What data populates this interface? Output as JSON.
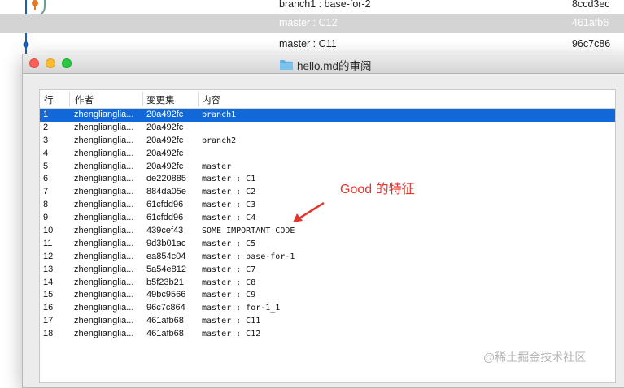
{
  "background_log": {
    "rows": [
      {
        "message": "branch1 : base-for-2",
        "hash": "8ccd3ec",
        "selected": false
      },
      {
        "message": "master : C12",
        "hash": "461afb6",
        "selected": true
      },
      {
        "message": "master : C11",
        "hash": "96c7c86",
        "selected": false
      }
    ],
    "graph_colors": {
      "main": "#1d5fb8",
      "branch": "#e07a2a",
      "line": "#6b9f87"
    }
  },
  "window": {
    "title": "hello.md的审阅",
    "folder_icon": "folder-icon"
  },
  "table": {
    "headers": {
      "line": "行",
      "author": "作者",
      "changeset": "变更集",
      "content": "内容"
    },
    "rows": [
      {
        "line": "1",
        "author": "zhenglianglia...",
        "changeset": "20a492fc",
        "content": "branch1",
        "selected": true
      },
      {
        "line": "2",
        "author": "zhenglianglia...",
        "changeset": "20a492fc",
        "content": ""
      },
      {
        "line": "3",
        "author": "zhenglianglia...",
        "changeset": "20a492fc",
        "content": "branch2"
      },
      {
        "line": "4",
        "author": "zhenglianglia...",
        "changeset": "20a492fc",
        "content": ""
      },
      {
        "line": "5",
        "author": "zhenglianglia...",
        "changeset": "20a492fc",
        "content": "master"
      },
      {
        "line": "6",
        "author": "zhenglianglia...",
        "changeset": "de220885",
        "content": "master : C1"
      },
      {
        "line": "7",
        "author": "zhenglianglia...",
        "changeset": "884da05e",
        "content": "master : C2"
      },
      {
        "line": "8",
        "author": "zhenglianglia...",
        "changeset": "61cfdd96",
        "content": "master : C3"
      },
      {
        "line": "9",
        "author": "zhenglianglia...",
        "changeset": "61cfdd96",
        "content": "master : C4"
      },
      {
        "line": "10",
        "author": "zhenglianglia...",
        "changeset": "439cef43",
        "content": "SOME IMPORTANT CODE"
      },
      {
        "line": "11",
        "author": "zhenglianglia...",
        "changeset": "9d3b01ac",
        "content": "master : C5"
      },
      {
        "line": "12",
        "author": "zhenglianglia...",
        "changeset": "ea854c04",
        "content": "master : base-for-1"
      },
      {
        "line": "13",
        "author": "zhenglianglia...",
        "changeset": "5a54e812",
        "content": "master : C7"
      },
      {
        "line": "14",
        "author": "zhenglianglia...",
        "changeset": "b5f23b21",
        "content": "master : C8"
      },
      {
        "line": "15",
        "author": "zhenglianglia...",
        "changeset": "49bc9566",
        "content": "master : C9"
      },
      {
        "line": "16",
        "author": "zhenglianglia...",
        "changeset": "96c7c864",
        "content": "master : for-1_1"
      },
      {
        "line": "17",
        "author": "zhenglianglia...",
        "changeset": "461afb68",
        "content": "master : C11"
      },
      {
        "line": "18",
        "author": "zhenglianglia...",
        "changeset": "461afb68",
        "content": "master : C12"
      }
    ]
  },
  "annotation": {
    "text": "Good 的特征",
    "color": "#e8332a"
  },
  "watermark": "@稀土掘金技术社区"
}
